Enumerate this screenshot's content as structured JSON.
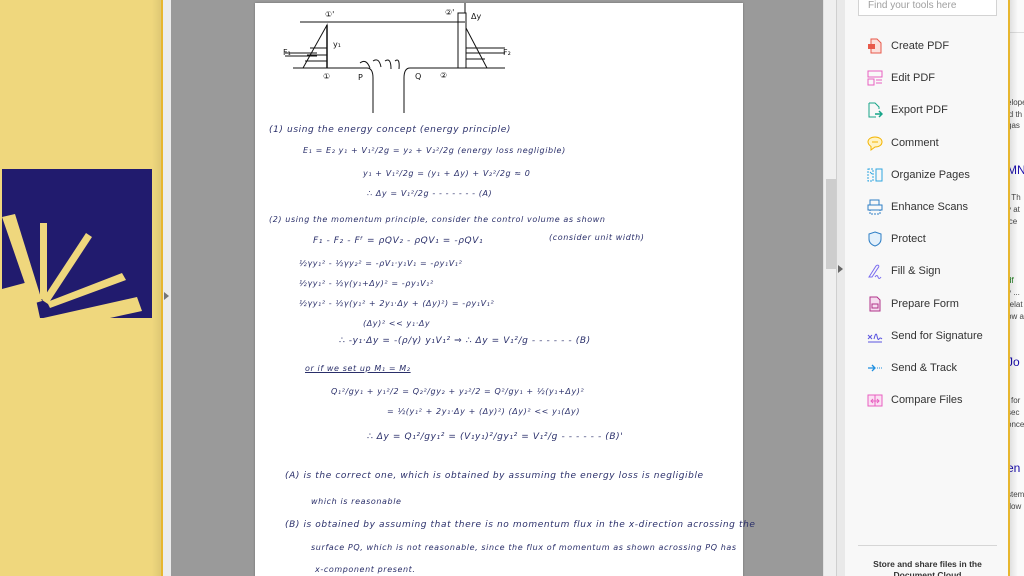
{
  "background_left": {
    "logo_icon": "starburst-logo",
    "colors": {
      "background": "#efd77d",
      "logo_bg": "#211b6e",
      "logo_rays": "#efd77d"
    }
  },
  "viewer": {
    "document": {
      "diagram_labels": [
        "①'",
        "②'",
        "F₁",
        "F₂",
        "y₁",
        "①",
        "P",
        "Q",
        "②",
        "Δy"
      ],
      "part1": {
        "heading": "(1) using the energy concept (energy principle)",
        "lines": [
          "E₁ = E₂      y₁ + V₁²/2g = y₂ + V₂²/2g      (energy loss negligible)",
          "y₁ + V₁²/2g = (y₁ + Δy) + V₂²/2g ≈ 0",
          "∴ Δy = V₁²/2g  - - - - - - - (A)"
        ]
      },
      "part2": {
        "heading": "(2) using the momentum principle, consider the control volume as shown",
        "note": "(consider unit width)",
        "lines": [
          "F₁ - F₂ - Fᶠ = ρQV₂ - ρQV₁ = -ρQV₁",
          "½γy₁² - ½γy₂² = -ρV₁·y₁V₁ = -ρy₁V₁²",
          "½γy₁² - ½γ(y₁+Δy)² = -ρy₁V₁²",
          "½γy₁² - ½γ(y₁² + 2y₁·Δy + (Δy)²) = -ρy₁V₁²",
          "(Δy)² << y₁·Δy",
          "∴ -y₁·Δy = -(ρ/γ) y₁V₁²      ⇒   ∴ Δy = V₁²/g  - - - - - - (B)"
        ]
      },
      "part3": {
        "heading": "or if we set up  M₁ = M₂",
        "lines": [
          "Q₁²/gy₁ + y₁²/2 = Q₂²/gy₂ + y₂²/2 = Q²/gy₁ + ½(y₁+Δy)²",
          "= ½(y₁² + 2y₁·Δy + (Δy)²)      (Δy)² << y₁(Δy)",
          "∴ Δy = Q₁²/gy₁² = (V₁y₁)²/gy₁² = V₁²/g  - - - - - - (B)'"
        ]
      },
      "conclusion": {
        "lines": [
          "(A) is the correct one, which is obtained by assuming the energy loss is negligible",
          "which is reasonable",
          "(B) is obtained by assuming that there is no momentum flux in the x-direction acrossing the",
          "surface PQ, which is not reasonable, since the flux of momentum as shown acrossing PQ has",
          "x-component present."
        ]
      }
    },
    "scrollbar": {
      "position_fraction": 0.34
    }
  },
  "tools_pane": {
    "search_placeholder": "Find your tools here",
    "items": [
      {
        "label": "Create PDF",
        "icon": "create-pdf-icon",
        "color": "#e8594a"
      },
      {
        "label": "Edit PDF",
        "icon": "edit-pdf-icon",
        "color": "#e85fc1"
      },
      {
        "label": "Export PDF",
        "icon": "export-pdf-icon",
        "color": "#17a589"
      },
      {
        "label": "Comment",
        "icon": "comment-icon",
        "color": "#f4b400"
      },
      {
        "label": "Organize Pages",
        "icon": "organize-pages-icon",
        "color": "#2fa6e0"
      },
      {
        "label": "Enhance Scans",
        "icon": "enhance-scans-icon",
        "color": "#2f7fc6"
      },
      {
        "label": "Protect",
        "icon": "protect-shield-icon",
        "color": "#2f7fc6"
      },
      {
        "label": "Fill & Sign",
        "icon": "fill-sign-icon",
        "color": "#7a6cf0"
      },
      {
        "label": "Prepare Form",
        "icon": "prepare-form-icon",
        "color": "#b1338a"
      },
      {
        "label": "Send for Signature",
        "icon": "send-signature-icon",
        "color": "#5a54e0"
      },
      {
        "label": "Send & Track",
        "icon": "send-track-icon",
        "color": "#1f8fe0"
      },
      {
        "label": "Compare Files",
        "icon": "compare-files-icon",
        "color": "#e85fc1"
      }
    ],
    "footer": "Store and share files in the Document Cloud"
  },
  "background_right": {
    "fragments": [
      "elope",
      "id th",
      "gas",
      "MN",
      ". Th",
      "y at",
      "ice",
      "df",
      "y ...",
      "relat",
      "ow a",
      "Jo",
      "l for",
      "sec",
      "once",
      "en b",
      "stem",
      "flow"
    ]
  }
}
